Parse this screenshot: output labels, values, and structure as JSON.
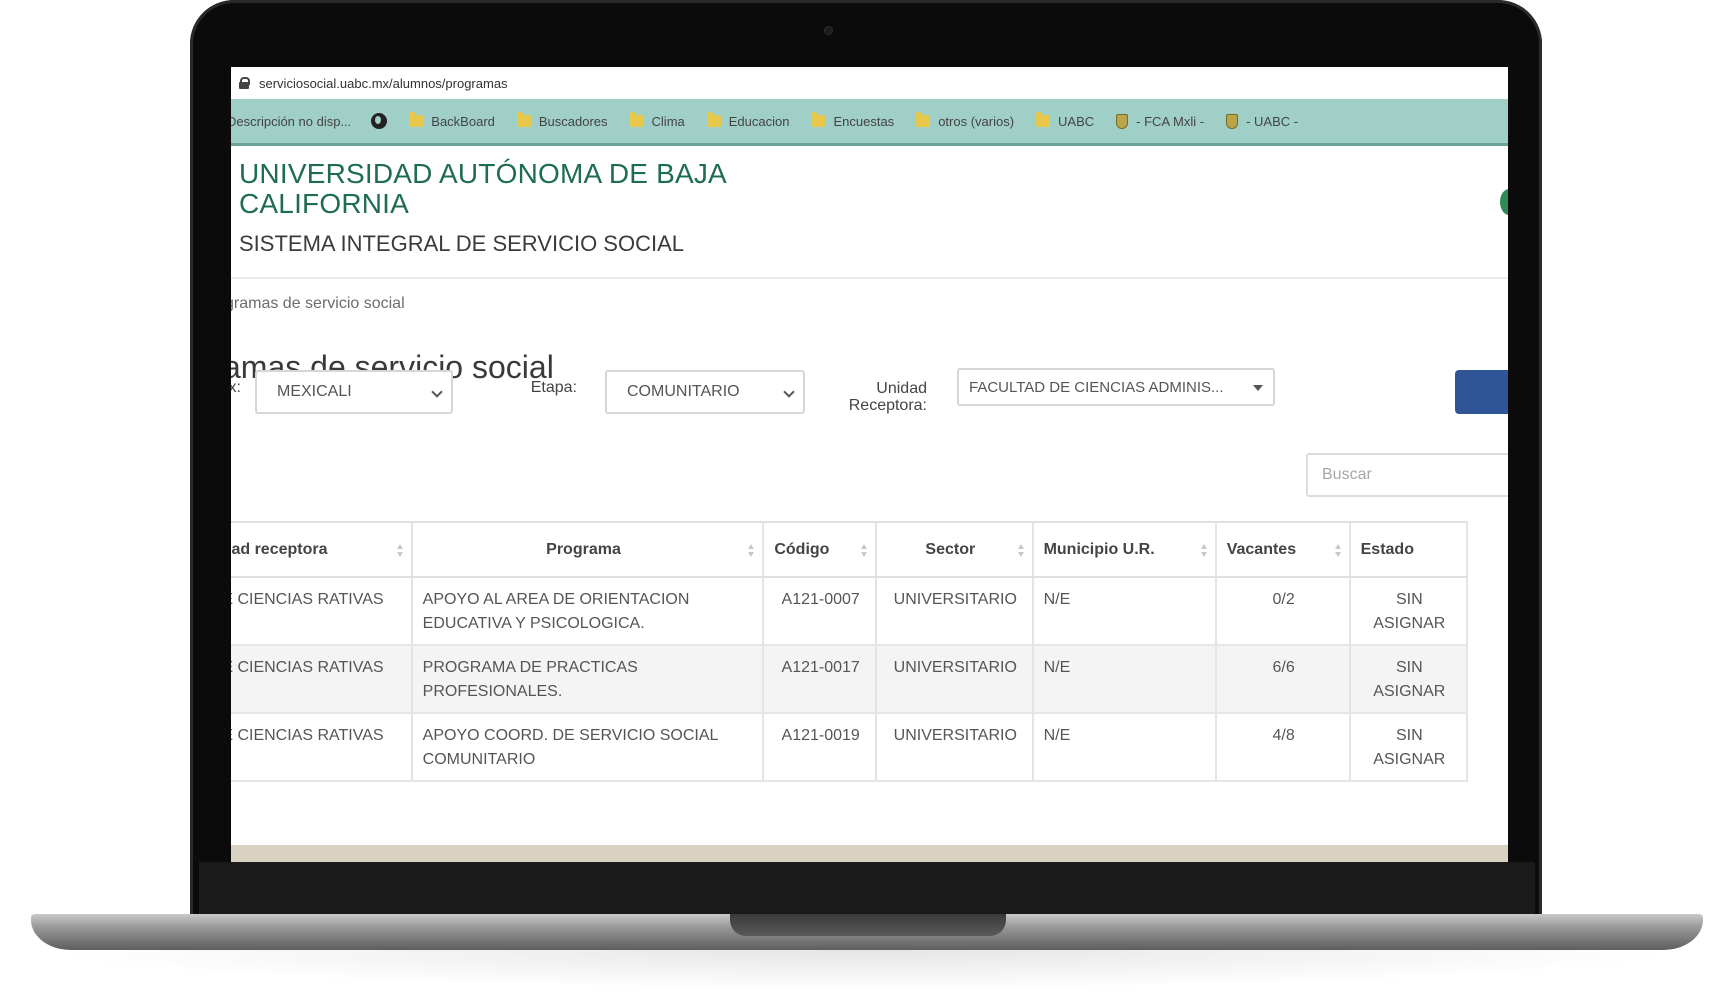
{
  "browser": {
    "url": "serviciosocial.uabc.mx/alumnos/programas",
    "bookmarks": [
      {
        "label": "Descripción no disp...",
        "icon": "none"
      },
      {
        "label": "",
        "icon": "globe-icon"
      },
      {
        "label": "BackBoard",
        "icon": "folder-icon"
      },
      {
        "label": "Buscadores",
        "icon": "folder-icon"
      },
      {
        "label": "Clima",
        "icon": "folder-icon"
      },
      {
        "label": "Educacion",
        "icon": "folder-icon"
      },
      {
        "label": "Encuestas",
        "icon": "folder-icon"
      },
      {
        "label": "otros (varios)",
        "icon": "folder-icon"
      },
      {
        "label": "UABC",
        "icon": "folder-icon"
      },
      {
        "label": "- FCA Mxli -",
        "icon": "shield-icon"
      },
      {
        "label": "- UABC -",
        "icon": "shield-icon"
      }
    ]
  },
  "header": {
    "university": "UNIVERSIDAD AUTÓNOMA DE BAJA CALIFORNIA",
    "system": "SISTEMA INTEGRAL DE SERVICIO SOCIAL"
  },
  "breadcrumb": "gramas de servicio social",
  "page_title": "amas de servicio social",
  "filters": {
    "campus_label": "x:",
    "campus_value": "MEXICALI",
    "etapa_label": "Etapa:",
    "etapa_value": "COMUNITARIO",
    "unidad_label_1": "Unidad",
    "unidad_label_2": "Receptora:",
    "unidad_value": "FACULTAD DE CIENCIAS ADMINIS...",
    "search_placeholder": "Buscar"
  },
  "table": {
    "headers": [
      "lad receptora",
      "Programa",
      "Código",
      "Sector",
      "Municipio U.R.",
      "Vacantes",
      "Estado"
    ],
    "rows": [
      {
        "unidad": ") DE CIENCIAS RATIVAS",
        "programa": "APOYO AL AREA DE ORIENTACION EDUCATIVA Y PSICOLOGICA.",
        "codigo": "A121-0007",
        "sector": "UNIVERSITARIO",
        "municipio": "N/E",
        "vacantes": "0/2",
        "estado": "SIN ASIGNAR"
      },
      {
        "unidad": ") DE CIENCIAS RATIVAS",
        "programa": "PROGRAMA DE PRACTICAS PROFESIONALES.",
        "codigo": "A121-0017",
        "sector": "UNIVERSITARIO",
        "municipio": "N/E",
        "vacantes": "6/6",
        "estado": "SIN ASIGNAR"
      },
      {
        "unidad": ") DE CIENCIAS RATIVAS",
        "programa": "APOYO COORD. DE SERVICIO SOCIAL COMUNITARIO",
        "codigo": "A121-0019",
        "sector": "UNIVERSITARIO",
        "municipio": "N/E",
        "vacantes": "4/8",
        "estado": "SIN ASIGNAR"
      }
    ]
  }
}
